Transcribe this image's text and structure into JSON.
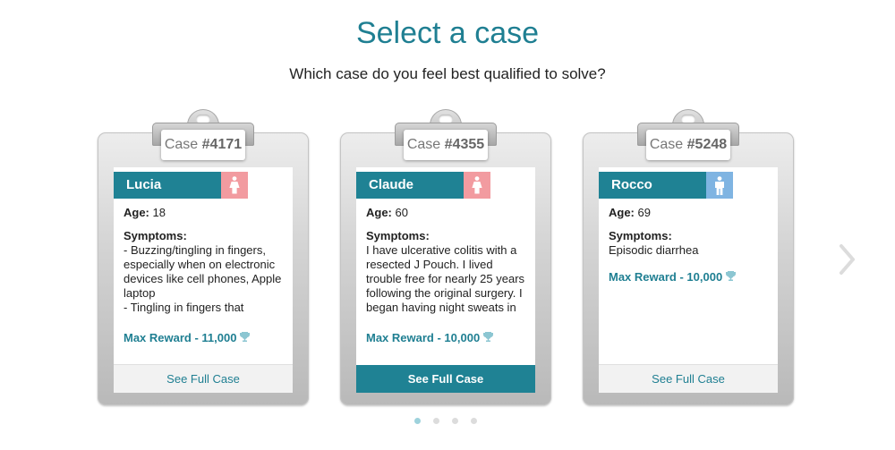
{
  "header": {
    "title": "Select a case",
    "subtitle": "Which case do you feel best qualified to solve?"
  },
  "colors": {
    "accent": "#1f8294",
    "female": "#f29ba0",
    "male": "#7fb4e2"
  },
  "cards": [
    {
      "case_prefix": "Case ",
      "case_number": "#4171",
      "name": "Lucia",
      "gender": "female",
      "age_label": "Age:",
      "age": " 18",
      "symptoms_label": "Symptoms:",
      "symptoms": "- Buzzing/tingling in fingers, especially when on electronic devices like cell phones, Apple laptop\n- Tingling in fingers that",
      "reward": "Max Reward - 11,000",
      "button": "See Full Case"
    },
    {
      "case_prefix": "Case ",
      "case_number": "#4355",
      "name": "Claude",
      "gender": "female",
      "age_label": "Age:",
      "age": " 60",
      "symptoms_label": "Symptoms:",
      "symptoms": "I have ulcerative colitis with a resected J Pouch. I lived trouble free for nearly 25 years following the original surgery. I began having night sweats in",
      "reward": "Max Reward - 10,000",
      "button": "See Full Case"
    },
    {
      "case_prefix": "Case ",
      "case_number": "#5248",
      "name": "Rocco",
      "gender": "male",
      "age_label": "Age:",
      "age": " 69",
      "symptoms_label": "Symptoms:",
      "symptoms": "Episodic diarrhea",
      "reward": "Max Reward - 10,000",
      "button": "See Full Case"
    }
  ],
  "carousel": {
    "active_page": 1,
    "total_pages": 4
  }
}
